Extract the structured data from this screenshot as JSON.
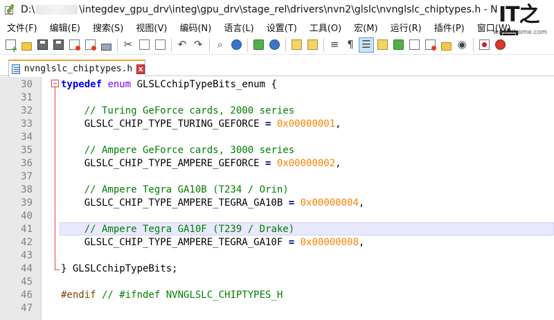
{
  "window": {
    "title_prefix": "D:\\",
    "title_path": "\\integdev_gpu_drv\\integ\\gpu_drv\\stage_rel\\drivers\\nvn2\\glslc\\nvnglslc_chiptypes.h - N",
    "watermark_logo": "IT之家",
    "watermark_url": "www.ithome.com"
  },
  "menu": {
    "items": [
      {
        "label": "文件(F)"
      },
      {
        "label": "编辑(E)"
      },
      {
        "label": "搜索(S)"
      },
      {
        "label": "视图(V)"
      },
      {
        "label": "编码(N)"
      },
      {
        "label": "语言(L)"
      },
      {
        "label": "设置(T)"
      },
      {
        "label": "工具(O)"
      },
      {
        "label": "宏(M)"
      },
      {
        "label": "运行(R)"
      },
      {
        "label": "插件(P)"
      },
      {
        "label": "窗口(W)"
      }
    ]
  },
  "toolbar": {
    "icons": [
      "new-file-icon",
      "open-file-icon",
      "save-icon",
      "save-all-icon",
      "close-icon",
      "close-all-icon",
      "print-icon",
      "cut-icon",
      "copy-icon",
      "paste-icon",
      "undo-icon",
      "redo-icon",
      "find-icon",
      "replace-icon",
      "zoom-in-icon",
      "zoom-out-icon",
      "sync-vertical-icon",
      "sync-horizontal-icon",
      "word-wrap-icon",
      "show-all-chars-icon",
      "indent-guide-icon",
      "udl-icon",
      "doc-map-icon",
      "function-list-icon",
      "folder-workspace-icon",
      "monitor-icon",
      "record-macro-icon"
    ]
  },
  "tab": {
    "label": "nvnglslc_chiptypes.h",
    "close": "x"
  },
  "editor": {
    "highlight_line": 41,
    "fold_start_line": 30,
    "fold_end_line": 44,
    "lines": [
      {
        "num": "30",
        "kw": "typedef",
        "kw2": " enum",
        "text": " GLSLCchipTypeBits_enum {",
        "cmt": "",
        "op": "",
        "num_val": "",
        "tail": ""
      },
      {
        "num": "31",
        "kw": "",
        "kw2": "",
        "text": "",
        "cmt": "",
        "op": "",
        "num_val": "",
        "tail": ""
      },
      {
        "num": "32",
        "kw": "",
        "kw2": "",
        "text": "    ",
        "cmt": "// Turing GeForce cards, 2000 series",
        "op": "",
        "num_val": "",
        "tail": ""
      },
      {
        "num": "33",
        "kw": "",
        "kw2": "",
        "text": "    GLSLC_CHIP_TYPE_TURING_GEFORCE ",
        "cmt": "",
        "op": "=",
        "num_val": " 0x00000001",
        "tail": ","
      },
      {
        "num": "34",
        "kw": "",
        "kw2": "",
        "text": "",
        "cmt": "",
        "op": "",
        "num_val": "",
        "tail": ""
      },
      {
        "num": "35",
        "kw": "",
        "kw2": "",
        "text": "    ",
        "cmt": "// Ampere GeForce cards, 3000 series",
        "op": "",
        "num_val": "",
        "tail": ""
      },
      {
        "num": "36",
        "kw": "",
        "kw2": "",
        "text": "    GLSLC_CHIP_TYPE_AMPERE_GEFORCE ",
        "cmt": "",
        "op": "=",
        "num_val": " 0x00000002",
        "tail": ","
      },
      {
        "num": "37",
        "kw": "",
        "kw2": "",
        "text": "",
        "cmt": "",
        "op": "",
        "num_val": "",
        "tail": ""
      },
      {
        "num": "38",
        "kw": "",
        "kw2": "",
        "text": "    ",
        "cmt": "// Ampere Tegra GA10B (T234 / Orin)",
        "op": "",
        "num_val": "",
        "tail": ""
      },
      {
        "num": "39",
        "kw": "",
        "kw2": "",
        "text": "    GLSLC_CHIP_TYPE_AMPERE_TEGRA_GA10B ",
        "cmt": "",
        "op": "=",
        "num_val": " 0x00000004",
        "tail": ","
      },
      {
        "num": "40",
        "kw": "",
        "kw2": "",
        "text": "",
        "cmt": "",
        "op": "",
        "num_val": "",
        "tail": ""
      },
      {
        "num": "41",
        "kw": "",
        "kw2": "",
        "text": "    ",
        "cmt": "// Ampere Tegra GA10F (T239 / Drake)",
        "op": "",
        "num_val": "",
        "tail": ""
      },
      {
        "num": "42",
        "kw": "",
        "kw2": "",
        "text": "    GLSLC_CHIP_TYPE_AMPERE_TEGRA_GA10F ",
        "cmt": "",
        "op": "=",
        "num_val": " 0x00000008",
        "tail": ","
      },
      {
        "num": "43",
        "kw": "",
        "kw2": "",
        "text": "",
        "cmt": "",
        "op": "",
        "num_val": "",
        "tail": ""
      },
      {
        "num": "44",
        "kw": "",
        "kw2": "",
        "text": "} GLSLCchipTypeBits;",
        "cmt": "",
        "op": "",
        "num_val": "",
        "tail": ""
      },
      {
        "num": "45",
        "kw": "",
        "kw2": "",
        "text": "",
        "cmt": "",
        "op": "",
        "num_val": "",
        "tail": ""
      },
      {
        "num": "46",
        "kw": "",
        "kw2": "",
        "text": "",
        "cmt": " // #ifndef NVNGLSLC_CHIPTYPES_H",
        "op": "",
        "num_val": "",
        "tail": "",
        "pre": "#endif"
      },
      {
        "num": "47",
        "kw": "",
        "kw2": "",
        "text": "",
        "cmt": "",
        "op": "",
        "num_val": "",
        "tail": ""
      }
    ]
  }
}
